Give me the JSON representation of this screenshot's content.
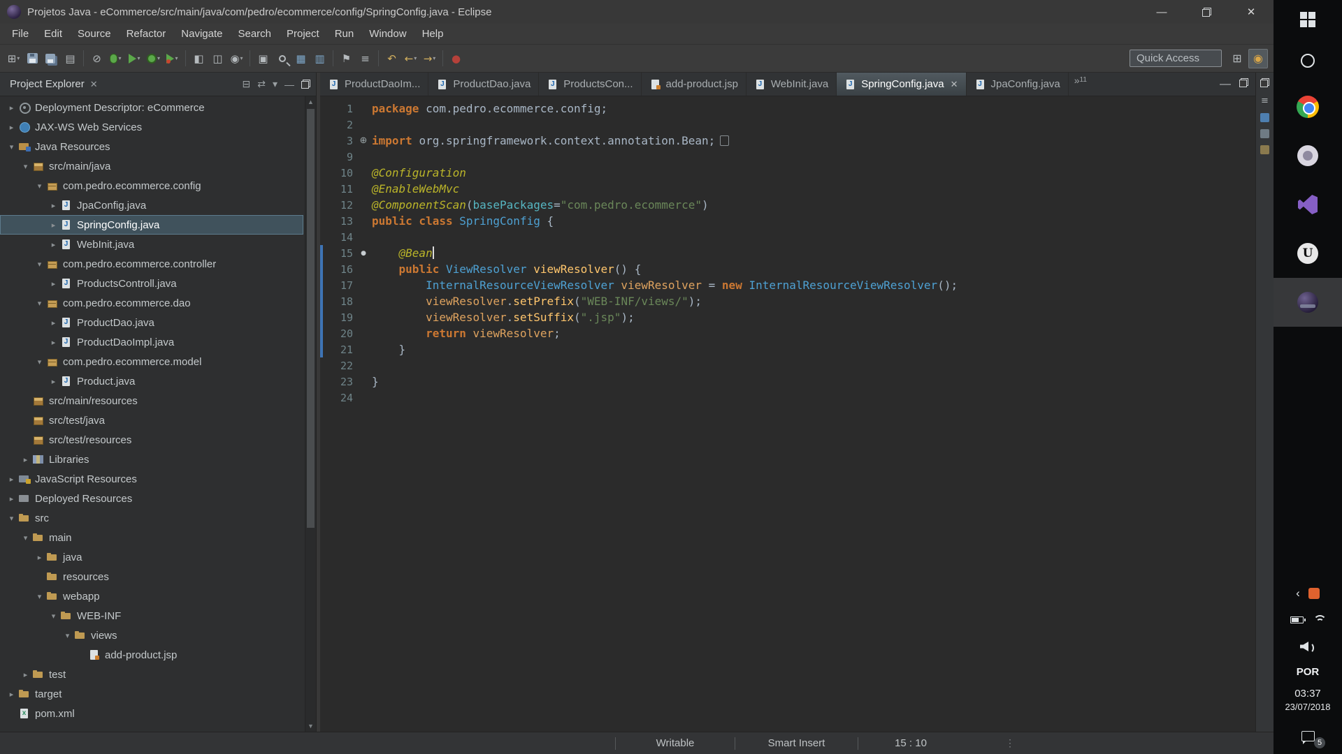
{
  "window": {
    "title": "Projetos Java - eCommerce/src/main/java/com/pedro/ecommerce/config/SpringConfig.java - Eclipse"
  },
  "menubar": {
    "items": [
      "File",
      "Edit",
      "Source",
      "Refactor",
      "Navigate",
      "Search",
      "Project",
      "Run",
      "Window",
      "Help"
    ]
  },
  "toolbar": {
    "quick_access": "Quick Access",
    "groups": [
      [
        {
          "name": "new-wizard",
          "glyph": "⊞",
          "caret": true
        },
        {
          "name": "save",
          "css": "floppy"
        },
        {
          "name": "save-all",
          "css": "floppy2"
        },
        {
          "name": "print",
          "glyph": "▤"
        }
      ],
      [
        {
          "name": "skip-all-breakpoints",
          "glyph": "⊘"
        },
        {
          "name": "debug",
          "css": "bug",
          "caret": true
        },
        {
          "name": "run",
          "css": "play",
          "caret": true
        },
        {
          "name": "coverage",
          "css": "cov",
          "caret": true
        },
        {
          "name": "external-tools",
          "css": "play2",
          "caret": true
        }
      ],
      [
        {
          "name": "new-ejb",
          "glyph": "◧"
        },
        {
          "name": "new-servlet",
          "glyph": "◫"
        },
        {
          "name": "new-class",
          "glyph": "◉",
          "caret": true
        }
      ],
      [
        {
          "name": "open-element",
          "glyph": "▣"
        },
        {
          "name": "search",
          "css": "mag"
        },
        {
          "name": "db-table",
          "glyph": "▦",
          "color": "#7da7c9"
        },
        {
          "name": "db-grid",
          "glyph": "▥",
          "color": "#7da7c9"
        }
      ],
      [
        {
          "name": "toggle-mark-occurrences",
          "glyph": "⚑"
        },
        {
          "name": "annotations",
          "glyph": "≡"
        }
      ],
      [
        {
          "name": "last-edit-location",
          "glyph": "↶",
          "color": "#d4b15f"
        },
        {
          "name": "back",
          "glyph": "←",
          "color": "#d4b15f",
          "caret": true
        },
        {
          "name": "forward",
          "glyph": "→",
          "color": "#d4b15f",
          "caret": true
        }
      ],
      [
        {
          "name": "record",
          "glyph": "●",
          "color": "#b5413a"
        }
      ]
    ],
    "perspectives": [
      {
        "name": "open-perspective",
        "glyph": "⊞",
        "pressed": false
      },
      {
        "name": "java-ee-perspective",
        "glyph": "◉",
        "pressed": true
      }
    ]
  },
  "explorer": {
    "title": "Project Explorer",
    "items": [
      {
        "label": "Deployment Descriptor: eCommerce",
        "depth": 0,
        "arrow": "col",
        "icon": "deploy"
      },
      {
        "label": "JAX-WS Web Services",
        "depth": 0,
        "arrow": "col",
        "icon": "ws"
      },
      {
        "label": "Java Resources",
        "depth": 0,
        "arrow": "exp",
        "icon": "javares"
      },
      {
        "label": "src/main/java",
        "depth": 1,
        "arrow": "exp",
        "icon": "srcfolder"
      },
      {
        "label": "com.pedro.ecommerce.config",
        "depth": 2,
        "arrow": "exp",
        "icon": "package"
      },
      {
        "label": "JpaConfig.java",
        "depth": 3,
        "arrow": "col",
        "icon": "jclass"
      },
      {
        "label": "SpringConfig.java",
        "depth": 3,
        "arrow": "col",
        "icon": "jclass",
        "selected": true
      },
      {
        "label": "WebInit.java",
        "depth": 3,
        "arrow": "col",
        "icon": "jclass"
      },
      {
        "label": "com.pedro.ecommerce.controller",
        "depth": 2,
        "arrow": "exp",
        "icon": "package"
      },
      {
        "label": "ProductsControll.java",
        "depth": 3,
        "arrow": "col",
        "icon": "jclass"
      },
      {
        "label": "com.pedro.ecommerce.dao",
        "depth": 2,
        "arrow": "exp",
        "icon": "package"
      },
      {
        "label": "ProductDao.java",
        "depth": 3,
        "arrow": "col",
        "icon": "jclass"
      },
      {
        "label": "ProductDaoImpl.java",
        "depth": 3,
        "arrow": "col",
        "icon": "jclass"
      },
      {
        "label": "com.pedro.ecommerce.model",
        "depth": 2,
        "arrow": "exp",
        "icon": "package"
      },
      {
        "label": "Product.java",
        "depth": 3,
        "arrow": "col",
        "icon": "jclass"
      },
      {
        "label": "src/main/resources",
        "depth": 1,
        "arrow": "none",
        "icon": "srcfolder"
      },
      {
        "label": "src/test/java",
        "depth": 1,
        "arrow": "none",
        "icon": "srcfolder"
      },
      {
        "label": "src/test/resources",
        "depth": 1,
        "arrow": "none",
        "icon": "srcfolder"
      },
      {
        "label": "Libraries",
        "depth": 1,
        "arrow": "col",
        "icon": "lib"
      },
      {
        "label": "JavaScript Resources",
        "depth": 0,
        "arrow": "col",
        "icon": "jsres"
      },
      {
        "label": "Deployed Resources",
        "depth": 0,
        "arrow": "col",
        "icon": "deployres"
      },
      {
        "label": "src",
        "depth": 0,
        "arrow": "exp",
        "icon": "folder"
      },
      {
        "label": "main",
        "depth": 1,
        "arrow": "exp",
        "icon": "folder"
      },
      {
        "label": "java",
        "depth": 2,
        "arrow": "col",
        "icon": "folder"
      },
      {
        "label": "resources",
        "depth": 2,
        "arrow": "none",
        "icon": "folder"
      },
      {
        "label": "webapp",
        "depth": 2,
        "arrow": "exp",
        "icon": "folder"
      },
      {
        "label": "WEB-INF",
        "depth": 3,
        "arrow": "exp",
        "icon": "folder"
      },
      {
        "label": "views",
        "depth": 4,
        "arrow": "exp",
        "icon": "folder"
      },
      {
        "label": "add-product.jsp",
        "depth": 5,
        "arrow": "none",
        "icon": "jsp"
      },
      {
        "label": "test",
        "depth": 1,
        "arrow": "col",
        "icon": "folder"
      },
      {
        "label": "target",
        "depth": 0,
        "arrow": "col",
        "icon": "folder"
      },
      {
        "label": "pom.xml",
        "depth": 0,
        "arrow": "none",
        "icon": "xml"
      }
    ]
  },
  "editor": {
    "tabs": [
      {
        "label": "ProductDaoIm...",
        "icon": "jclass",
        "active": false
      },
      {
        "label": "ProductDao.java",
        "icon": "jclass",
        "active": false
      },
      {
        "label": "ProductsCon...",
        "icon": "jclass",
        "active": false
      },
      {
        "label": "add-product.jsp",
        "icon": "jsp",
        "active": false
      },
      {
        "label": "WebInit.java",
        "icon": "jclass",
        "active": false
      },
      {
        "label": "SpringConfig.java",
        "icon": "jclass",
        "active": true
      },
      {
        "label": "JpaConfig.java",
        "icon": "jclass",
        "active": false
      }
    ],
    "overflow_symbol": "»",
    "overflow_count": "11",
    "code": [
      {
        "n": "1",
        "s": [
          [
            "k",
            "package "
          ],
          [
            "p",
            "com.pedro.ecommerce.config;"
          ]
        ]
      },
      {
        "n": "2",
        "s": []
      },
      {
        "n": "3",
        "mark": "plus",
        "fold": true,
        "s": [
          [
            "k",
            "import "
          ],
          [
            "p",
            "org.springframework.context.annotation.Bean;"
          ]
        ]
      },
      {
        "n": "9",
        "s": []
      },
      {
        "n": "10",
        "s": [
          [
            "a",
            "@Configuration"
          ]
        ]
      },
      {
        "n": "11",
        "s": [
          [
            "a",
            "@EnableWebMvc"
          ]
        ]
      },
      {
        "n": "12",
        "s": [
          [
            "a",
            "@ComponentScan"
          ],
          [
            "p",
            "("
          ],
          [
            "at",
            "basePackages"
          ],
          [
            "p",
            "="
          ],
          [
            "s",
            "\"com.pedro.ecommerce\""
          ],
          [
            "p",
            ")"
          ]
        ]
      },
      {
        "n": "13",
        "s": [
          [
            "k",
            "public class "
          ],
          [
            "t",
            "SpringConfig"
          ],
          [
            "p",
            " {"
          ]
        ]
      },
      {
        "n": "14",
        "s": []
      },
      {
        "n": "15",
        "mark": "dot",
        "chg": true,
        "caret": true,
        "s": [
          [
            "p",
            "    "
          ],
          [
            "a",
            "@Bean"
          ]
        ]
      },
      {
        "n": "16",
        "chg": true,
        "s": [
          [
            "p",
            "    "
          ],
          [
            "k",
            "public "
          ],
          [
            "t",
            "ViewResolver"
          ],
          [
            "p",
            " "
          ],
          [
            "m",
            "viewResolver"
          ],
          [
            "p",
            "() {"
          ]
        ]
      },
      {
        "n": "17",
        "chg": true,
        "s": [
          [
            "p",
            "        "
          ],
          [
            "t",
            "InternalResourceViewResolver"
          ],
          [
            "p",
            " "
          ],
          [
            "v",
            "viewResolver"
          ],
          [
            "p",
            " = "
          ],
          [
            "k",
            "new"
          ],
          [
            "p",
            " "
          ],
          [
            "t",
            "InternalResourceViewResolver"
          ],
          [
            "p",
            "();"
          ]
        ]
      },
      {
        "n": "18",
        "chg": true,
        "s": [
          [
            "p",
            "        "
          ],
          [
            "v",
            "viewResolver"
          ],
          [
            "p",
            "."
          ],
          [
            "m",
            "setPrefix"
          ],
          [
            "p",
            "("
          ],
          [
            "s",
            "\"WEB-INF/views/\""
          ],
          [
            "p",
            ");"
          ]
        ]
      },
      {
        "n": "19",
        "chg": true,
        "s": [
          [
            "p",
            "        "
          ],
          [
            "v",
            "viewResolver"
          ],
          [
            "p",
            "."
          ],
          [
            "m",
            "setSuffix"
          ],
          [
            "p",
            "("
          ],
          [
            "s",
            "\".jsp\""
          ],
          [
            "p",
            ");"
          ]
        ]
      },
      {
        "n": "20",
        "chg": true,
        "s": [
          [
            "p",
            "        "
          ],
          [
            "k",
            "return "
          ],
          [
            "v",
            "viewResolver"
          ],
          [
            "p",
            ";"
          ]
        ]
      },
      {
        "n": "21",
        "chg": true,
        "s": [
          [
            "p",
            "    }"
          ]
        ]
      },
      {
        "n": "22",
        "s": []
      },
      {
        "n": "23",
        "s": [
          [
            "p",
            "}"
          ]
        ]
      },
      {
        "n": "24",
        "s": []
      }
    ]
  },
  "statusbar": {
    "writable": "Writable",
    "insert_mode": "Smart Insert",
    "caret_position": "15 : 10"
  },
  "taskbar": {
    "language": "POR",
    "time": "03:37",
    "date": "23/07/2018",
    "badge": "5"
  }
}
